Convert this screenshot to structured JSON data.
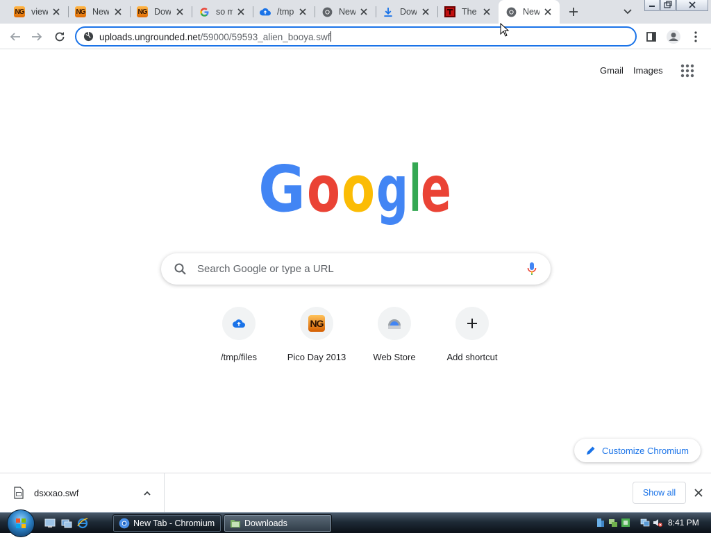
{
  "tabs": [
    {
      "title": "view",
      "favicon": "newgrounds-icon"
    },
    {
      "title": "Newgrounds",
      "favicon": "newgrounds-icon"
    },
    {
      "title": "Download",
      "favicon": "newgrounds-icon"
    },
    {
      "title": "so m",
      "favicon": "google-icon"
    },
    {
      "title": "/tmp",
      "favicon": "cloud-upload-icon"
    },
    {
      "title": "New",
      "favicon": "chromium-icon"
    },
    {
      "title": "Download",
      "favicon": "download-icon"
    },
    {
      "title": "The",
      "favicon": "red-square-icon"
    },
    {
      "title": "New",
      "favicon": "chromium-icon",
      "active": true
    }
  ],
  "omnibox": {
    "host": "uploads.ungrounded.net",
    "path": "/59000/59593_alien_booya.swf"
  },
  "header": {
    "gmail": "Gmail",
    "images": "Images"
  },
  "search": {
    "placeholder": "Search Google or type a URL"
  },
  "shortcuts": [
    {
      "label": "/tmp/files",
      "icon": "cloud-upload-icon"
    },
    {
      "label": "Pico Day 2013",
      "icon": "newgrounds-icon"
    },
    {
      "label": "Web Store",
      "icon": "web-store-icon"
    },
    {
      "label": "Add shortcut",
      "icon": "plus-icon"
    }
  ],
  "customize": {
    "label": "Customize Chromium"
  },
  "download_shelf": {
    "filename": "dsxxao.swf",
    "show_all": "Show all"
  },
  "taskbar": {
    "tasks": [
      {
        "label": "New Tab - Chromium"
      },
      {
        "label": "Downloads"
      }
    ],
    "clock": "8:41 PM"
  },
  "colors": {
    "accent": "#1a73e8",
    "google_blue": "#4285f4",
    "google_red": "#ea4335",
    "google_yellow": "#fbbc05",
    "google_green": "#34a853"
  }
}
